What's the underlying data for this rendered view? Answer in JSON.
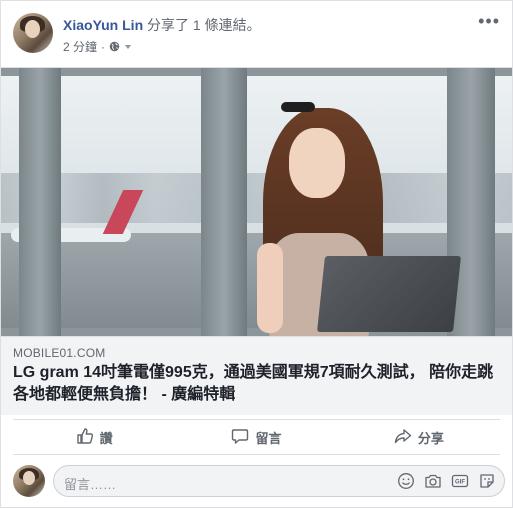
{
  "post": {
    "author": "XiaoYun Lin",
    "action": "分享了 1 條連結。",
    "time": "2 分鐘",
    "separator": "·",
    "more": "•••"
  },
  "link": {
    "domain": "MOBILE01.COM",
    "title": "LG gram 14吋筆電僅995克，通過美國軍規7項耐久測試， 陪你走跳各地都輕便無負擔！ - 廣編特輯"
  },
  "actions": {
    "like": "讚",
    "comment": "留言",
    "share": "分享"
  },
  "comment": {
    "placeholder": "留言……"
  },
  "icons": {
    "privacy": "globe-icon",
    "like": "thumbs-up-icon",
    "comment": "speech-bubble-icon",
    "share": "share-arrow-icon",
    "emoji": "smiley-icon",
    "camera": "camera-icon",
    "gif": "gif-icon",
    "sticker": "sticker-icon"
  },
  "colors": {
    "author_link": "#365899",
    "secondary_text": "#606770",
    "preview_bg": "#f2f3f5",
    "divider": "#dddfe2"
  }
}
